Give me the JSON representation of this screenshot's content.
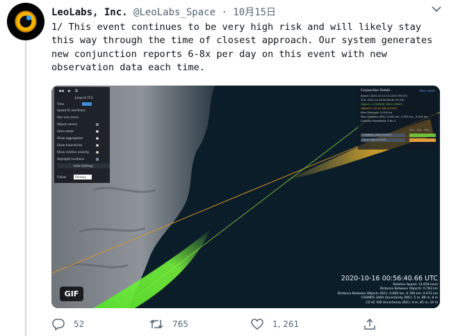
{
  "tweet": {
    "author_name": "LeoLabs, Inc.",
    "author_handle": "@LeoLabs_Space",
    "separator": "·",
    "date": "10月15日",
    "text": "1/ This event continues to be very high risk and will likely stay this way through the time of closest approach. Our system generates new conjunction reports 6-8x per day on this event with new observation data each time."
  },
  "media": {
    "control_panel": {
      "jump_label": "Jump to TCA",
      "time_label": "Time",
      "speed_label": "Speed (6 real-time)",
      "star_size_label": "Star size (mm)",
      "rows": [
        {
          "label": "Object names",
          "checked": true
        },
        {
          "label": "Auto-rotate",
          "checked": false
        },
        {
          "label": "Show aggregated",
          "checked": false
        },
        {
          "label": "Show trajectories",
          "checked": false
        },
        {
          "label": "Show relative velocity",
          "checked": false
        },
        {
          "label": "Highlight locations",
          "checked": true
        }
      ],
      "hide_button": "Hide Settings",
      "follow_label": "Follow",
      "follow_value": "Primary"
    },
    "conjunction_panel": {
      "title": "Conjunction Details",
      "view_link": "View report",
      "lines": [
        "Epoch:       2020-10-14 12:10:07.98 UTC",
        "TCA:         2020-10-16 00:56:40.70 UTC",
        "Object 1:    COSMOS 2004 (19567)",
        "Object 2:    CZ-4C R/B (27297)",
        "Miss Distance:      0.016 km",
        "Miss Distance (RIC): 0.002 km, 0.002 km, -0.016 km",
        "Collision Probability:   5.6e-3"
      ],
      "table_rows": [
        "COSMOS 2004 (19567)",
        "CZ-4C R/B (27297)"
      ],
      "table_cols": [
        "1-σ",
        "2-σ",
        "3-σ"
      ]
    },
    "overlay": {
      "timestamp": "2020-10-16 00:56:40.66 UTC",
      "lines": [
        "Relative Speed: 14.659 km/s",
        "Distance Between Objects: 0.763 km",
        "Distance Between Objects (RIC): 0.000 km, 0.760 km, 0.072 km",
        "COSMOS 2004 Uncertainty (RIC): 5 m, 89 m, 8 m",
        "CZ-4C R/B Uncertainty (RIC): 4 m, 85 m, 10 m"
      ]
    },
    "gif_badge": "GIF"
  },
  "actions": {
    "replies": "52",
    "retweets": "765",
    "likes": "1, 261"
  },
  "colors": {
    "earth_night": "#0b1d29",
    "cloud": "#8a9096",
    "object1_track": "#ffd34d",
    "object2_track": "#7cff3a",
    "accent_link": "#1d9bf0"
  }
}
